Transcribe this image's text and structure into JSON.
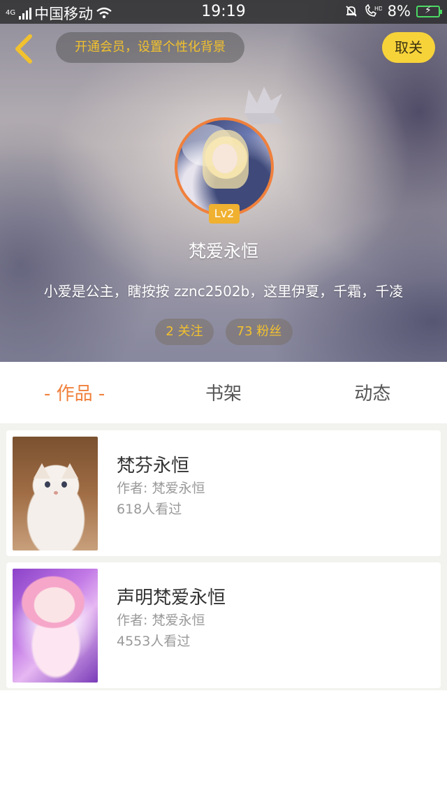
{
  "status_bar": {
    "network": "4G",
    "carrier": "中国移动",
    "time": "19:19",
    "battery": "8%",
    "icons": [
      "signal-icon",
      "wifi-icon",
      "mute-bell-icon",
      "hd-call-icon",
      "battery-charging-icon"
    ]
  },
  "header": {
    "back_icon": "chevron-left-icon",
    "vip_banner": "开通会员，设置个性化背景",
    "unfollow_label": "取关"
  },
  "profile": {
    "level": "Lv2",
    "nickname": "梵爱永恒",
    "bio": "小爱是公主，瞎按按 zznc2502b，这里伊夏，千霜，千凌",
    "following": "2 关注",
    "fans": "73 粉丝"
  },
  "tabs": [
    {
      "label": "- 作品 -",
      "active": true
    },
    {
      "label": "书架",
      "active": false
    },
    {
      "label": "动态",
      "active": false
    }
  ],
  "works": [
    {
      "title": "梵芬永恒",
      "author": "作者: 梵爱永恒",
      "views": "618人看过",
      "thumb": "kitten-cover"
    },
    {
      "title": "声明梵爱永恒",
      "author": "作者: 梵爱永恒",
      "views": "4553人看过",
      "thumb": "anime-girl-cover"
    }
  ],
  "colors": {
    "accent": "#f0803c",
    "gold": "#f2c12e",
    "unfollow_bg": "#f7d33a",
    "level_badge": "#f0b030"
  }
}
